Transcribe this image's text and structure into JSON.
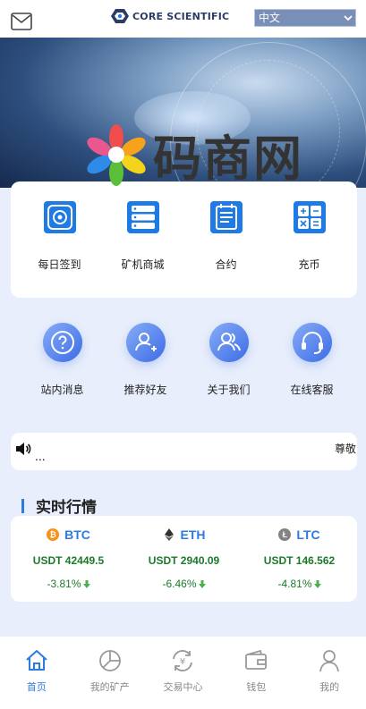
{
  "header": {
    "mail_icon": "mail-icon",
    "logo_text": "CORE SCIENTIFIC",
    "language_select": {
      "selected": "中文",
      "icon": "chevron-down-icon"
    }
  },
  "watermark": {
    "text": "码商网"
  },
  "quick_actions": [
    {
      "label": "每日签到",
      "icon": "sign-in-icon"
    },
    {
      "label": "矿机商城",
      "icon": "server-icon"
    },
    {
      "label": "合约",
      "icon": "contract-icon"
    },
    {
      "label": "充币",
      "icon": "calculator-icon"
    }
  ],
  "secondary_actions": [
    {
      "label": "站内消息",
      "icon": "question-icon"
    },
    {
      "label": "推荐好友",
      "icon": "add-user-icon"
    },
    {
      "label": "关于我们",
      "icon": "users-icon"
    },
    {
      "label": "在线客服",
      "icon": "headset-icon"
    }
  ],
  "notice": {
    "icon": "speaker-icon",
    "dots": "...",
    "scroll_text": "尊敬"
  },
  "market": {
    "title": "实时行情",
    "coins": [
      {
        "symbol": "BTC",
        "price": "USDT 42449.5",
        "change": "-3.81%",
        "icon": "btc-icon",
        "color": "#f7931a"
      },
      {
        "symbol": "ETH",
        "price": "USDT 2940.09",
        "change": "-6.46%",
        "icon": "eth-icon",
        "color": "#333333"
      },
      {
        "symbol": "LTC",
        "price": "USDT 146.562",
        "change": "-4.81%",
        "icon": "ltc-icon",
        "color": "#838383"
      }
    ]
  },
  "tabbar": [
    {
      "label": "首页",
      "icon": "home-icon",
      "active": true
    },
    {
      "label": "我的矿产",
      "icon": "pie-chart-icon",
      "active": false
    },
    {
      "label": "交易中心",
      "icon": "exchange-icon",
      "active": false
    },
    {
      "label": "钱包",
      "icon": "wallet-icon",
      "active": false
    },
    {
      "label": "我的",
      "icon": "profile-icon",
      "active": false
    }
  ],
  "colors": {
    "accent": "#2b7be0",
    "positive_text": "#1a7a2a",
    "background": "#e8eefb"
  }
}
